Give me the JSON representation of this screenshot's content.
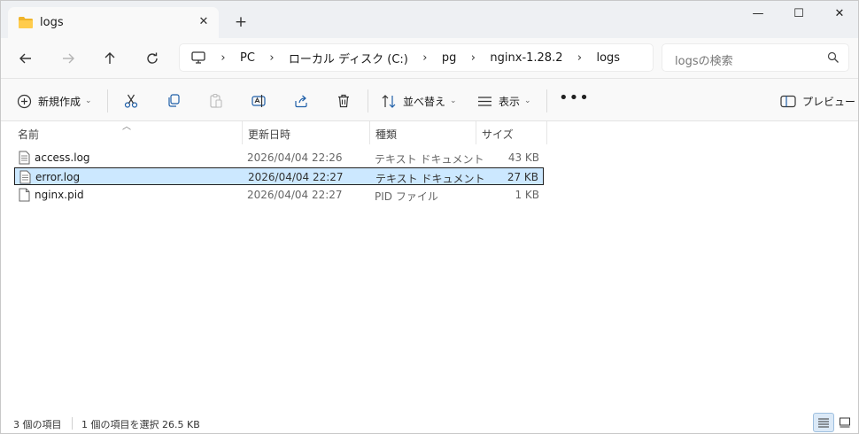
{
  "tab": {
    "title": "logs"
  },
  "window": {
    "minimize": "—",
    "maximize": "☐",
    "close": "✕",
    "tab_close": "✕",
    "new_tab": "+"
  },
  "breadcrumb": [
    "PC",
    "ローカル ディスク (C:)",
    "pg",
    "nginx-1.28.2",
    "logs"
  ],
  "breadcrumb_sep": "›",
  "search": {
    "placeholder": "logsの検索"
  },
  "toolbar": {
    "new_label": "新規作成",
    "sort_label": "並べ替え",
    "view_label": "表示",
    "more_label": "•••",
    "preview_label": "プレビュー"
  },
  "columns": [
    "名前",
    "更新日時",
    "種類",
    "サイズ"
  ],
  "files": [
    {
      "name": "access.log",
      "date": "2026/04/04 22:26",
      "type": "テキスト ドキュメント",
      "size": "43 KB",
      "selected": false
    },
    {
      "name": "error.log",
      "date": "2026/04/04 22:27",
      "type": "テキスト ドキュメント",
      "size": "27 KB",
      "selected": true
    },
    {
      "name": "nginx.pid",
      "date": "2026/04/04 22:27",
      "type": "PID ファイル",
      "size": "1 KB",
      "selected": false
    }
  ],
  "status": {
    "count": "3 個の項目",
    "selection": "1 個の項目を選択  26.5 KB"
  },
  "icons": {
    "folder": "folder-icon",
    "back": "back-arrow-icon",
    "forward": "forward-arrow-icon",
    "up": "up-arrow-icon",
    "refresh": "refresh-icon",
    "computer": "computer-icon",
    "search": "search-icon",
    "cut": "cut-icon",
    "copy": "copy-icon",
    "paste": "paste-icon",
    "rename": "rename-icon",
    "share": "share-icon",
    "delete": "trash-icon",
    "sort": "sort-icon",
    "view": "view-icon",
    "preview": "preview-pane-icon",
    "file": "text-file-icon",
    "details": "details-view-icon",
    "tiles": "tiles-view-icon"
  },
  "colors": {
    "selection_bg": "#cce8ff",
    "accent": "#005fb8",
    "folder": "#f0b429"
  }
}
